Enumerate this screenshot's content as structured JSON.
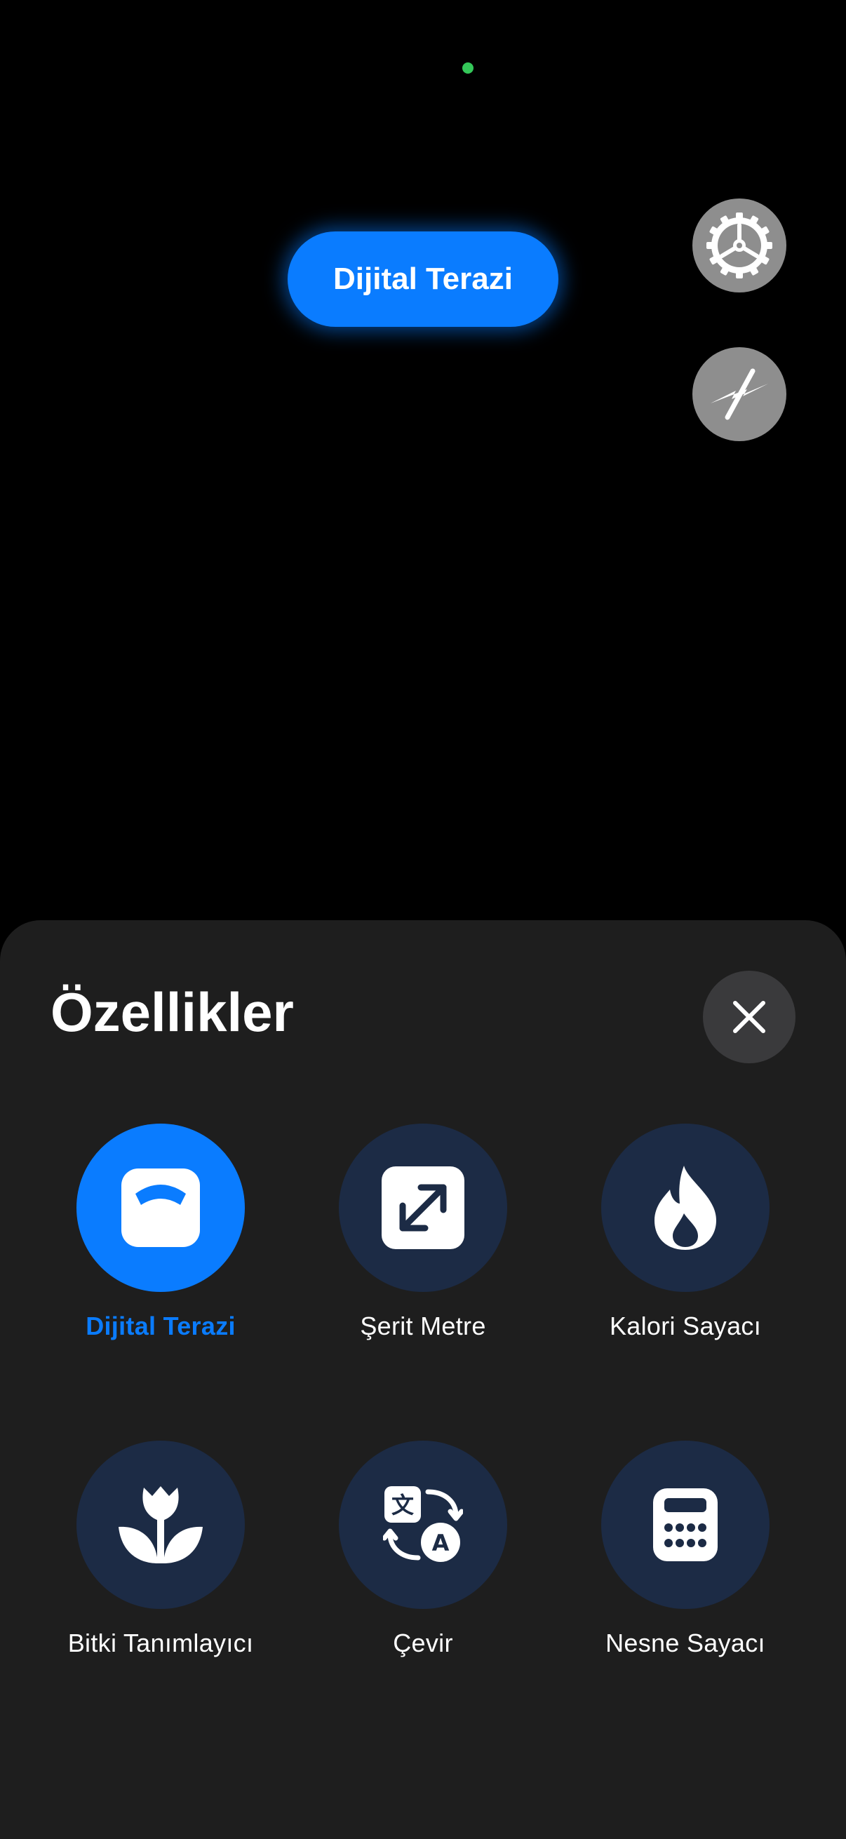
{
  "camera": {
    "mode_label": "Dijital Terazi",
    "status_dot_color": "#34c759",
    "buttons": [
      {
        "name": "settings",
        "icon": "gear-icon"
      },
      {
        "name": "flash-off",
        "icon": "flash-off-icon"
      }
    ]
  },
  "sheet": {
    "title": "Özellikler",
    "close_icon": "close-icon",
    "accent_color": "#0a7cff",
    "features": [
      {
        "label": "Dijital Terazi",
        "icon": "scale-icon",
        "selected": true
      },
      {
        "label": "Şerit Metre",
        "icon": "expand-arrows-icon",
        "selected": false
      },
      {
        "label": "Kalori Sayacı",
        "icon": "flame-icon",
        "selected": false
      },
      {
        "label": "Bitki Tanımlayıcı",
        "icon": "tulip-icon",
        "selected": false
      },
      {
        "label": "Çevir",
        "icon": "translate-icon",
        "selected": false
      },
      {
        "label": "Nesne Sayacı",
        "icon": "calculator-icon",
        "selected": false
      }
    ]
  }
}
